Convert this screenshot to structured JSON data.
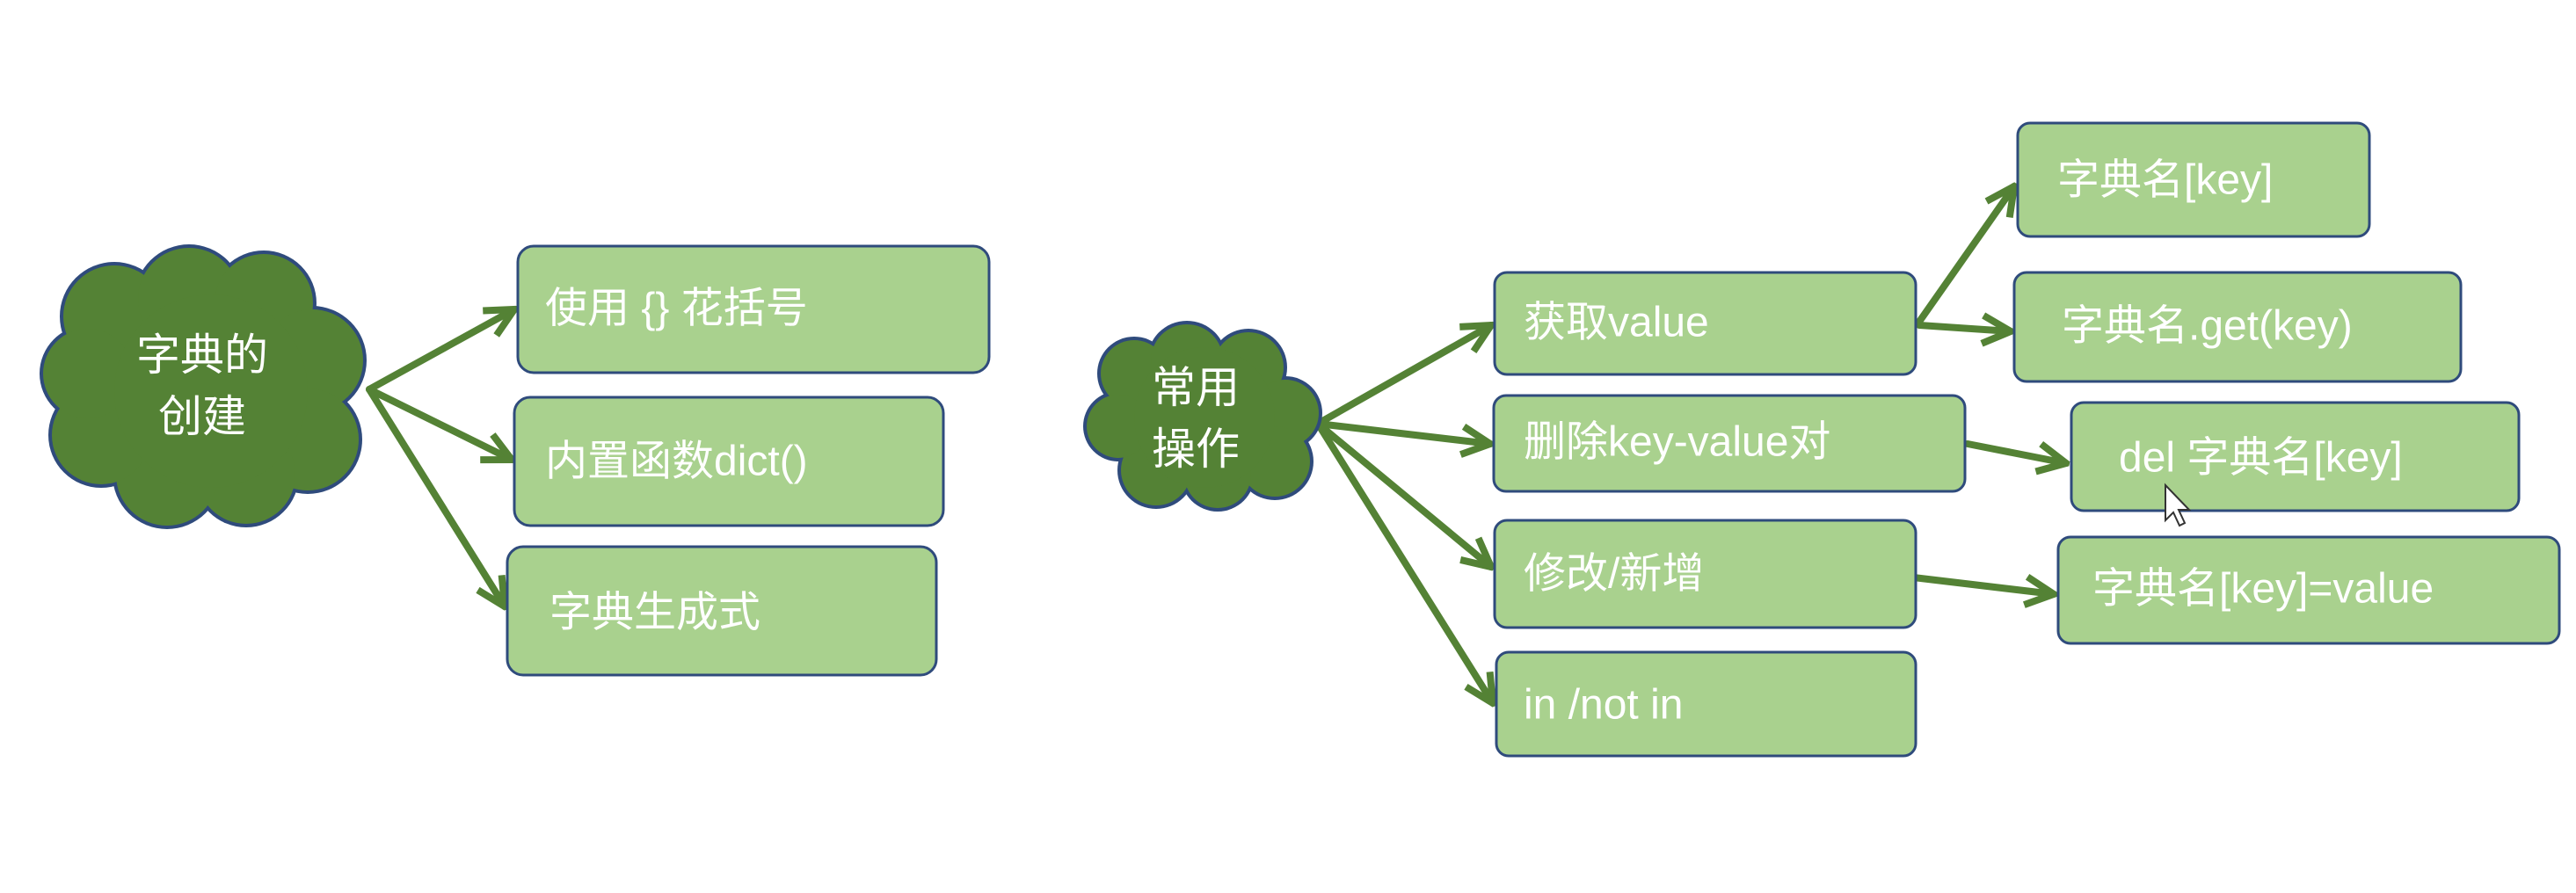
{
  "colors": {
    "node_fill": "#a9d18e",
    "node_border": "#2f4b7c",
    "cloud_fill": "#548235",
    "arrow": "#548235",
    "text": "#ffffff"
  },
  "creation": {
    "root": {
      "line1": "字典的",
      "line2": "创建"
    },
    "children": [
      "使用 {} 花括号",
      "内置函数dict()",
      "字典生成式"
    ]
  },
  "operations": {
    "root": {
      "line1": "常用",
      "line2": "操作"
    },
    "children": [
      "获取value",
      "删除key-value对",
      "修改/新增",
      "in  /not in"
    ],
    "get_methods": [
      "字典名[key]",
      "字典名.get(key)"
    ],
    "delete_syntax": "del 字典名[key]",
    "modify_syntax": "字典名[key]=value"
  }
}
